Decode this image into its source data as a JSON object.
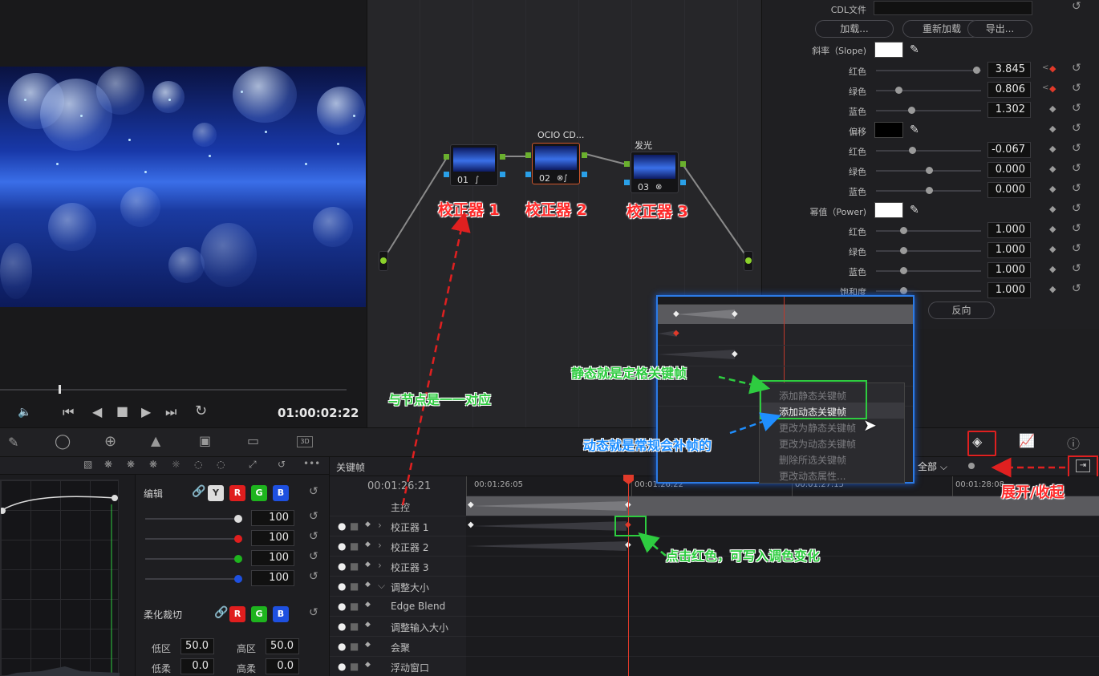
{
  "viewer": {
    "timecode": "01:00:02:22"
  },
  "nodes": {
    "node1": {
      "num": "01",
      "title": ""
    },
    "node2": {
      "num": "02",
      "title": "OCIO CD..."
    },
    "node3": {
      "num": "03",
      "title": "发光"
    }
  },
  "annotations": {
    "corrector1": "校正器 1",
    "corrector2": "校正器 2",
    "corrector3": "校正器 3",
    "one_to_one": "与节点是一一对应",
    "static_note": "静态就是定格关键帧",
    "dynamic_note": "动态就是常规会补帧的",
    "click_red": "点击红色，可写入调色变化",
    "expand": "展开/收起"
  },
  "cdl": {
    "file_label": "CDL文件",
    "btn_load": "加载...",
    "btn_reload": "重新加载",
    "btn_export": "导出...",
    "slope_label": "斜率（Slope)",
    "offset_label": "偏移",
    "power_label": "幂值（Power)",
    "sat_label": "饱和度",
    "red": "红色",
    "green": "绿色",
    "blue": "蓝色",
    "slope_r": "3.845",
    "slope_g": "0.806",
    "slope_b": "1.302",
    "offset_r": "-0.067",
    "offset_g": "0.000",
    "offset_b": "0.000",
    "power_r": "1.000",
    "power_g": "1.000",
    "power_b": "1.000",
    "sat": "1.000",
    "reverse": "反向"
  },
  "edit_panel": {
    "edit_label": "编辑",
    "soft_clip_label": "柔化裁切",
    "y": "Y",
    "r": "R",
    "g": "G",
    "b": "B",
    "v1": "100",
    "v2": "100",
    "v3": "100",
    "v4": "100",
    "low": "低区",
    "high": "高区",
    "low_val": "50.0",
    "high_val": "50.0",
    "low_soft": "低柔",
    "high_soft": "高柔",
    "low_soft_val": "0.0",
    "high_soft_val": "0.0"
  },
  "keyframes": {
    "title": "关键帧",
    "current_tc": "00:01:26:21",
    "filter": "全部",
    "ticks": [
      "00:01:26:05",
      "00:01:26:22",
      "00:01:27:15",
      "00:01:28:08"
    ],
    "tracks": [
      "主控",
      "校正器 1",
      "校正器 2",
      "校正器 3",
      "调整大小",
      "Edge Blend",
      "调整输入大小",
      "会聚",
      "浮动窗口"
    ]
  },
  "context_menu": {
    "items": [
      "添加静态关键帧",
      "添加动态关键帧",
      "更改为静态关键帧",
      "更改为动态关键帧",
      "删除所选关键帧",
      "更改动态属性..."
    ]
  }
}
